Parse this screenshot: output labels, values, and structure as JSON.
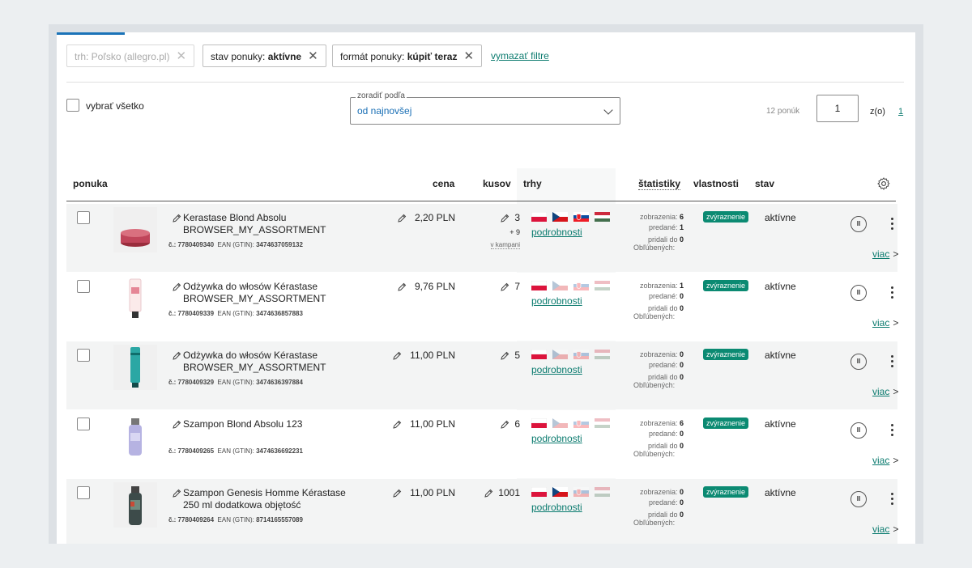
{
  "filters": {
    "chips": [
      {
        "label": "trh: Poľsko (allegro.pl)",
        "disabled": true
      },
      {
        "label_prefix": "stav ponuky:",
        "label_value": "aktívne"
      },
      {
        "label_prefix": "formát ponuky:",
        "label_value": "kúpiť teraz"
      }
    ],
    "clear_label": "vymazať filtre"
  },
  "toolbar": {
    "select_all_label": "vybrať všetko",
    "sort_legend": "zoradiť podľa",
    "sort_value": "od najnovšej",
    "offer_count": "12 ponúk",
    "page_value": "1",
    "page_of_label": "z(o)",
    "page_total": "1"
  },
  "columns": {
    "offer": "ponuka",
    "price": "cena",
    "qty": "kusov",
    "markets": "trhy",
    "stats": "štatistiky",
    "properties": "vlastnosti",
    "state": "stav"
  },
  "rows": [
    {
      "title_line1": "Kerastase Blond Absolu",
      "title_line2": "BROWSER_MY_ASSORTMENT",
      "id_label": "č.: 7780409340",
      "ean_label": "EAN (GTIN):",
      "ean": "3474637059132",
      "price": "2,20 PLN",
      "qty": "3",
      "qty_extra": "+ 9",
      "qty_campaign": "v kampani",
      "details_label": "podrobnosti",
      "views_label": "zobrazenia:",
      "views": "6",
      "sold_label": "predané:",
      "sold": "1",
      "fav_label1": "pridali do",
      "fav": "0",
      "fav_label2": "Obľúbených:",
      "badge": "zvýraznenie",
      "state": "aktívne",
      "more_label": "viac",
      "flags_active": [
        true,
        true,
        true,
        true
      ],
      "bg": "#f3f4f4",
      "product": "pink-jar"
    },
    {
      "title_line1": "Odżywka do włosów Kérastase",
      "title_line2": "BROWSER_MY_ASSORTMENT",
      "id_label": "č.: 7780409339",
      "ean_label": "EAN (GTIN):",
      "ean": "3474636857883",
      "price": "9,76 PLN",
      "qty": "7",
      "details_label": "podrobnosti",
      "views_label": "zobrazenia:",
      "views": "1",
      "sold_label": "predané:",
      "sold": "0",
      "fav_label1": "pridali do",
      "fav": "0",
      "fav_label2": "Obľúbených:",
      "badge": "zvýraznenie",
      "state": "aktívne",
      "more_label": "viac",
      "flags_active": [
        true,
        false,
        false,
        false
      ],
      "bg": "#ffffff",
      "product": "pink-tube"
    },
    {
      "title_line1": "Odżywka do włosów Kérastase",
      "title_line2": "BROWSER_MY_ASSORTMENT",
      "id_label": "č.: 7780409329",
      "ean_label": "EAN (GTIN):",
      "ean": "3474636397884",
      "price": "11,00 PLN",
      "qty": "5",
      "details_label": "podrobnosti",
      "views_label": "zobrazenia:",
      "views": "0",
      "sold_label": "predané:",
      "sold": "0",
      "fav_label1": "pridali do",
      "fav": "0",
      "fav_label2": "Obľúbených:",
      "badge": "zvýraznenie",
      "state": "aktívne",
      "more_label": "viac",
      "flags_active": [
        true,
        false,
        false,
        false
      ],
      "bg": "#f3f4f4",
      "product": "teal-tube"
    },
    {
      "title_line1": "Szampon Blond Absolu 123",
      "title_line2": "",
      "id_label": "č.: 7780409265",
      "ean_label": "EAN (GTIN):",
      "ean": "3474636692231",
      "price": "11,00 PLN",
      "qty": "6",
      "details_label": "podrobnosti",
      "views_label": "zobrazenia:",
      "views": "6",
      "sold_label": "predané:",
      "sold": "0",
      "fav_label1": "pridali do",
      "fav": "0",
      "fav_label2": "Obľúbených:",
      "badge": "zvýraznenie",
      "state": "aktívne",
      "more_label": "viac",
      "flags_active": [
        true,
        false,
        false,
        false
      ],
      "bg": "#ffffff",
      "product": "lilac-bottle"
    },
    {
      "title_line1": "Szampon Genesis Homme Kérastase",
      "title_line2": "250 ml dodatkowa objętość",
      "id_label": "č.: 7780409264",
      "ean_label": "EAN (GTIN):",
      "ean": "8714165557089",
      "price": "11,00 PLN",
      "qty": "1001",
      "details_label": "podrobnosti",
      "views_label": "zobrazenia:",
      "views": "0",
      "sold_label": "predané:",
      "sold": "0",
      "fav_label1": "pridali do",
      "fav": "0",
      "fav_label2": "Obľúbených:",
      "badge": "zvýraznenie",
      "state": "aktívne",
      "more_label": "viac",
      "flags_active": [
        true,
        true,
        false,
        false
      ],
      "bg": "#f3f4f4",
      "product": "dark-bottle"
    }
  ],
  "colors": {
    "accent": "#1a73b8",
    "link": "#0b7b6f",
    "badge": "#0b8a72",
    "sort_value": "#1a6fb5"
  },
  "icons": [
    "pencil-icon",
    "settings-gear-icon",
    "pause-icon",
    "kebab-menu-icon",
    "chevron-right-icon",
    "chevron-down-icon",
    "close-icon"
  ]
}
